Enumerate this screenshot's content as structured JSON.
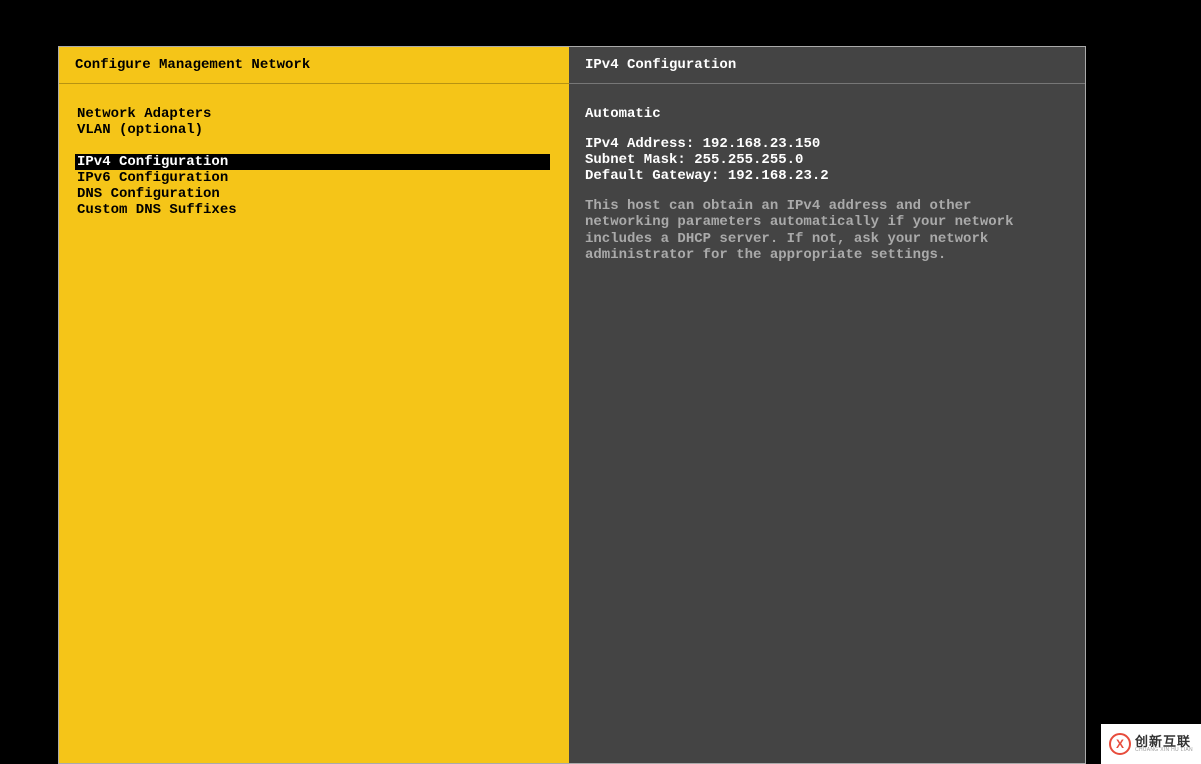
{
  "left": {
    "title": "Configure Management Network",
    "group1": [
      {
        "label": "Network Adapters"
      },
      {
        "label": "VLAN (optional)"
      }
    ],
    "group2": [
      {
        "label": "IPv4 Configuration",
        "selected": true
      },
      {
        "label": "IPv6 Configuration"
      },
      {
        "label": "DNS Configuration"
      },
      {
        "label": "Custom DNS Suffixes"
      }
    ]
  },
  "right": {
    "title": "IPv4 Configuration",
    "mode": "Automatic",
    "ipv4_address_label": "IPv4 Address: ",
    "ipv4_address_value": "192.168.23.150",
    "subnet_mask_label": "Subnet Mask: ",
    "subnet_mask_value": "255.255.255.0",
    "gateway_label": "Default Gateway: ",
    "gateway_value": "192.168.23.2",
    "description": "This host can obtain an IPv4 address and other networking parameters automatically if your network includes a DHCP server. If not, ask your network administrator for the appropriate settings."
  },
  "watermark": {
    "cn": "创新互联",
    "en": "CHUANG XIN HU LIAN"
  }
}
